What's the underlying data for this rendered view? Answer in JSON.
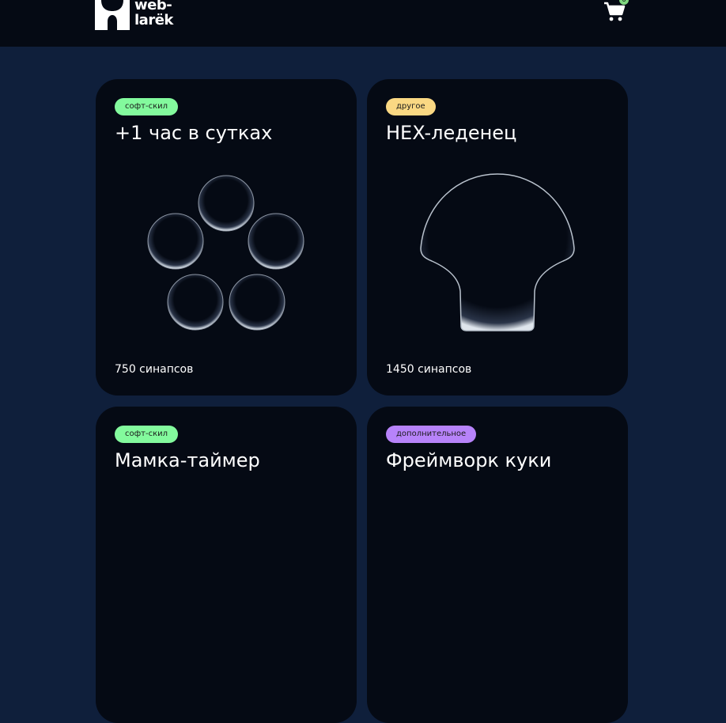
{
  "header": {
    "logo_text_1": "web-",
    "logo_text_2": "larëk",
    "basket_icon": "cart-icon",
    "basket_count": "0"
  },
  "colors": {
    "page_background": "#0f1f3b",
    "header_background": "#050a14",
    "card_background": "#050a14",
    "category_soft": "#83fa9d",
    "category_other": "#fad883",
    "category_additional": "#b783fa"
  },
  "cards": [
    {
      "category": "софт-скил",
      "category_color": "#83fa9d",
      "title": "+1 час в сутках",
      "image": "five-circles-icon",
      "price": "750 синапсов"
    },
    {
      "category": "другое",
      "category_color": "#fad883",
      "title": "HEX-леденец",
      "image": "lollipop-shell-icon",
      "price": "1450 синапсов"
    },
    {
      "category": "софт-скил",
      "category_color": "#83fa9d",
      "title": "Мамка-таймер",
      "image": "",
      "price": ""
    },
    {
      "category": "дополнительное",
      "category_color": "#b783fa",
      "title": "Фреймворк куки",
      "image": "",
      "price": ""
    }
  ]
}
